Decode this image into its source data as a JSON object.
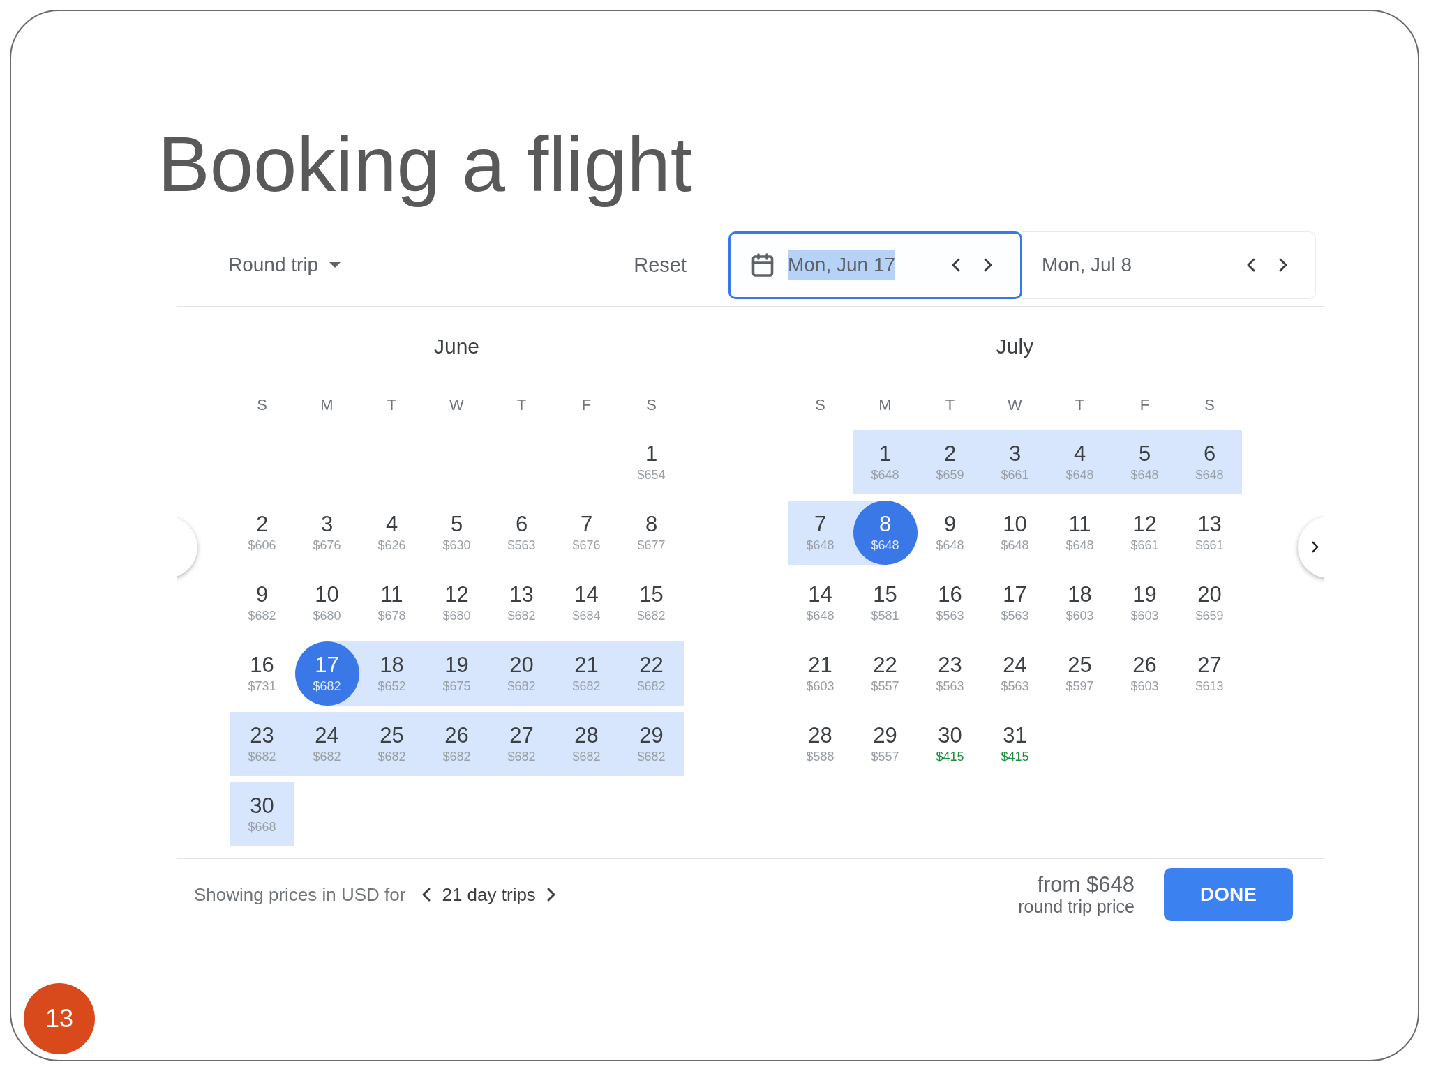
{
  "slide": {
    "title": "Booking a flight",
    "page_number": "13"
  },
  "header": {
    "trip_type": "Round trip",
    "reset": "Reset",
    "dates": [
      {
        "value": "Mon, Jun 17",
        "focused": true
      },
      {
        "value": "Mon, Jul 8",
        "focused": false
      }
    ]
  },
  "months": [
    {
      "name": "June",
      "weekdays": [
        "S",
        "M",
        "T",
        "W",
        "T",
        "F",
        "S"
      ],
      "weeks": [
        [
          {
            "day": "1",
            "price": "$654",
            "selected": false,
            "in_range": false,
            "deal": false
          }
        ],
        [
          {
            "day": "2",
            "price": "$606",
            "selected": false,
            "in_range": false,
            "deal": false
          },
          {
            "day": "3",
            "price": "$676",
            "selected": false,
            "in_range": false,
            "deal": false
          },
          {
            "day": "4",
            "price": "$626",
            "selected": false,
            "in_range": false,
            "deal": false
          },
          {
            "day": "5",
            "price": "$630",
            "selected": false,
            "in_range": false,
            "deal": false
          },
          {
            "day": "6",
            "price": "$563",
            "selected": false,
            "in_range": false,
            "deal": false
          },
          {
            "day": "7",
            "price": "$676",
            "selected": false,
            "in_range": false,
            "deal": false
          },
          {
            "day": "8",
            "price": "$677",
            "selected": false,
            "in_range": false,
            "deal": false
          }
        ],
        [
          {
            "day": "9",
            "price": "$682",
            "selected": false,
            "in_range": false,
            "deal": false
          },
          {
            "day": "10",
            "price": "$680",
            "selected": false,
            "in_range": false,
            "deal": false
          },
          {
            "day": "11",
            "price": "$678",
            "selected": false,
            "in_range": false,
            "deal": false
          },
          {
            "day": "12",
            "price": "$680",
            "selected": false,
            "in_range": false,
            "deal": false
          },
          {
            "day": "13",
            "price": "$682",
            "selected": false,
            "in_range": false,
            "deal": false
          },
          {
            "day": "14",
            "price": "$684",
            "selected": false,
            "in_range": false,
            "deal": false
          },
          {
            "day": "15",
            "price": "$682",
            "selected": false,
            "in_range": false,
            "deal": false
          }
        ],
        [
          {
            "day": "16",
            "price": "$731",
            "selected": false,
            "in_range": false,
            "deal": false
          },
          {
            "day": "17",
            "price": "$682",
            "selected": true,
            "in_range": true,
            "deal": false
          },
          {
            "day": "18",
            "price": "$652",
            "selected": false,
            "in_range": true,
            "deal": false
          },
          {
            "day": "19",
            "price": "$675",
            "selected": false,
            "in_range": true,
            "deal": false
          },
          {
            "day": "20",
            "price": "$682",
            "selected": false,
            "in_range": true,
            "deal": false
          },
          {
            "day": "21",
            "price": "$682",
            "selected": false,
            "in_range": true,
            "deal": false
          },
          {
            "day": "22",
            "price": "$682",
            "selected": false,
            "in_range": true,
            "deal": false
          }
        ],
        [
          {
            "day": "23",
            "price": "$682",
            "selected": false,
            "in_range": true,
            "deal": false
          },
          {
            "day": "24",
            "price": "$682",
            "selected": false,
            "in_range": true,
            "deal": false
          },
          {
            "day": "25",
            "price": "$682",
            "selected": false,
            "in_range": true,
            "deal": false
          },
          {
            "day": "26",
            "price": "$682",
            "selected": false,
            "in_range": true,
            "deal": false
          },
          {
            "day": "27",
            "price": "$682",
            "selected": false,
            "in_range": true,
            "deal": false
          },
          {
            "day": "28",
            "price": "$682",
            "selected": false,
            "in_range": true,
            "deal": false
          },
          {
            "day": "29",
            "price": "$682",
            "selected": false,
            "in_range": true,
            "deal": false
          }
        ],
        [
          {
            "day": "30",
            "price": "$668",
            "selected": false,
            "in_range": true,
            "deal": false
          }
        ]
      ]
    },
    {
      "name": "July",
      "weekdays": [
        "S",
        "M",
        "T",
        "W",
        "T",
        "F",
        "S"
      ],
      "weeks": [
        [
          {
            "day": "1",
            "price": "$648",
            "selected": false,
            "in_range": true,
            "deal": false
          },
          {
            "day": "2",
            "price": "$659",
            "selected": false,
            "in_range": true,
            "deal": false
          },
          {
            "day": "3",
            "price": "$661",
            "selected": false,
            "in_range": true,
            "deal": false
          },
          {
            "day": "4",
            "price": "$648",
            "selected": false,
            "in_range": true,
            "deal": false
          },
          {
            "day": "5",
            "price": "$648",
            "selected": false,
            "in_range": true,
            "deal": false
          },
          {
            "day": "6",
            "price": "$648",
            "selected": false,
            "in_range": true,
            "deal": false
          }
        ],
        [
          {
            "day": "7",
            "price": "$648",
            "selected": false,
            "in_range": true,
            "deal": false
          },
          {
            "day": "8",
            "price": "$648",
            "selected": true,
            "in_range": true,
            "deal": false
          },
          {
            "day": "9",
            "price": "$648",
            "selected": false,
            "in_range": false,
            "deal": false
          },
          {
            "day": "10",
            "price": "$648",
            "selected": false,
            "in_range": false,
            "deal": false
          },
          {
            "day": "11",
            "price": "$648",
            "selected": false,
            "in_range": false,
            "deal": false
          },
          {
            "day": "12",
            "price": "$661",
            "selected": false,
            "in_range": false,
            "deal": false
          },
          {
            "day": "13",
            "price": "$661",
            "selected": false,
            "in_range": false,
            "deal": false
          }
        ],
        [
          {
            "day": "14",
            "price": "$648",
            "selected": false,
            "in_range": false,
            "deal": false
          },
          {
            "day": "15",
            "price": "$581",
            "selected": false,
            "in_range": false,
            "deal": false
          },
          {
            "day": "16",
            "price": "$563",
            "selected": false,
            "in_range": false,
            "deal": false
          },
          {
            "day": "17",
            "price": "$563",
            "selected": false,
            "in_range": false,
            "deal": false
          },
          {
            "day": "18",
            "price": "$603",
            "selected": false,
            "in_range": false,
            "deal": false
          },
          {
            "day": "19",
            "price": "$603",
            "selected": false,
            "in_range": false,
            "deal": false
          },
          {
            "day": "20",
            "price": "$659",
            "selected": false,
            "in_range": false,
            "deal": false
          }
        ],
        [
          {
            "day": "21",
            "price": "$603",
            "selected": false,
            "in_range": false,
            "deal": false
          },
          {
            "day": "22",
            "price": "$557",
            "selected": false,
            "in_range": false,
            "deal": false
          },
          {
            "day": "23",
            "price": "$563",
            "selected": false,
            "in_range": false,
            "deal": false
          },
          {
            "day": "24",
            "price": "$563",
            "selected": false,
            "in_range": false,
            "deal": false
          },
          {
            "day": "25",
            "price": "$597",
            "selected": false,
            "in_range": false,
            "deal": false
          },
          {
            "day": "26",
            "price": "$603",
            "selected": false,
            "in_range": false,
            "deal": false
          },
          {
            "day": "27",
            "price": "$613",
            "selected": false,
            "in_range": false,
            "deal": false
          }
        ],
        [
          {
            "day": "28",
            "price": "$588",
            "selected": false,
            "in_range": false,
            "deal": false
          },
          {
            "day": "29",
            "price": "$557",
            "selected": false,
            "in_range": false,
            "deal": false
          },
          {
            "day": "30",
            "price": "$415",
            "selected": false,
            "in_range": false,
            "deal": true
          },
          {
            "day": "31",
            "price": "$415",
            "selected": false,
            "in_range": false,
            "deal": true
          }
        ]
      ]
    }
  ],
  "footer": {
    "showing": "Showing prices in USD for",
    "trip_length": "21 day trips",
    "from_price": "from $648",
    "price_note": "round trip price",
    "done": "DONE"
  }
}
